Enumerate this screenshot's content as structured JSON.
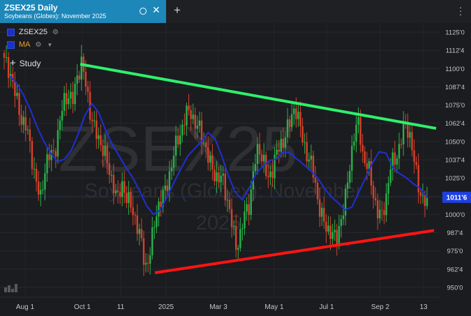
{
  "tab": {
    "title": "ZSEX25 Daily",
    "subtitle": "Soybeans (Globex): November 2025",
    "new_tab": "+"
  },
  "legend": {
    "symbol": "ZSEX25",
    "ma": "MA",
    "study": "Study"
  },
  "watermark": {
    "big": "ZSEX25",
    "line1": "Soybeans (Globex): November",
    "line2": "2025"
  },
  "colors": {
    "up": "#28b24a",
    "down": "#d9412b",
    "ma": "#1f2fd6",
    "resistance": "#2ef06d",
    "support": "#ff1414",
    "price_tag": "#1e40e0",
    "tab": "#1c87b8"
  },
  "chart_data": {
    "type": "candlestick",
    "y_ticks": [
      "1125'0",
      "1112'4",
      "1100'0",
      "1087'4",
      "1075'0",
      "1062'4",
      "1050'0",
      "1037'4",
      "1025'0",
      "1012'4",
      "1000'0",
      "987'4",
      "975'0",
      "962'4",
      "950'0"
    ],
    "ylim": [
      943.75,
      1131.25
    ],
    "x_ticks": [
      "Aug 1",
      "Oct 1",
      "11",
      "2025",
      "Mar 3",
      "May 1",
      "Jul 1",
      "Sep 2",
      "13"
    ],
    "last_price": "1011'6",
    "series": [
      {
        "name": "ZSEX25",
        "kind": "ohlc-close",
        "values": [
          1105,
          1097,
          1088,
          1078,
          1065,
          1055,
          1040,
          1025,
          1012,
          1030,
          1038,
          1045,
          1060,
          1075,
          1080,
          1078,
          1098,
          1102,
          1085,
          1070,
          1060,
          1050,
          1040,
          1030,
          1025,
          1010,
          1018,
          1010,
          1008,
          997,
          980,
          962,
          975,
          995,
          1005,
          1010,
          1025,
          1040,
          1048,
          1055,
          1070,
          1075,
          1060,
          1055,
          1050,
          1040,
          1030,
          1020,
          1025,
          1015,
          995,
          975,
          985,
          1005,
          1010,
          1030,
          1045,
          1040,
          1025,
          1030,
          1040,
          1050,
          1060,
          1062,
          1072,
          1062,
          1050,
          1038,
          1025,
          1010,
          1000,
          990,
          985,
          980,
          1000,
          1010,
          1030,
          1055,
          1065,
          1040,
          1030,
          1015,
          1005,
          1000,
          1010,
          1030,
          1040,
          1050,
          1060,
          1055,
          1040,
          1025,
          1010,
          1003
        ]
      },
      {
        "name": "MA",
        "kind": "line",
        "values": [
          1095,
          1090,
          1082,
          1072,
          1060,
          1050,
          1042,
          1036,
          1038,
          1044,
          1055,
          1068,
          1076,
          1070,
          1058,
          1048,
          1040,
          1032,
          1025,
          1016,
          1006,
          1000,
          1003,
          1012,
          1022,
          1031,
          1040,
          1045,
          1050,
          1056,
          1052,
          1040,
          1026,
          1015,
          1010,
          1018,
          1028,
          1033,
          1037,
          1038,
          1043,
          1042,
          1038,
          1034,
          1030,
          1025,
          1018,
          1012,
          1008,
          1003,
          1005,
          1015,
          1025,
          1035,
          1043,
          1042,
          1032,
          1028,
          1025,
          1021,
          1018,
          1012
        ]
      }
    ],
    "trendlines": [
      {
        "name": "resistance",
        "from": [
          "Oct 1",
          1103
        ],
        "to": [
          "end",
          1059
        ]
      },
      {
        "name": "support",
        "from": [
          "2025",
          960
        ],
        "to": [
          "end",
          989
        ]
      }
    ]
  }
}
